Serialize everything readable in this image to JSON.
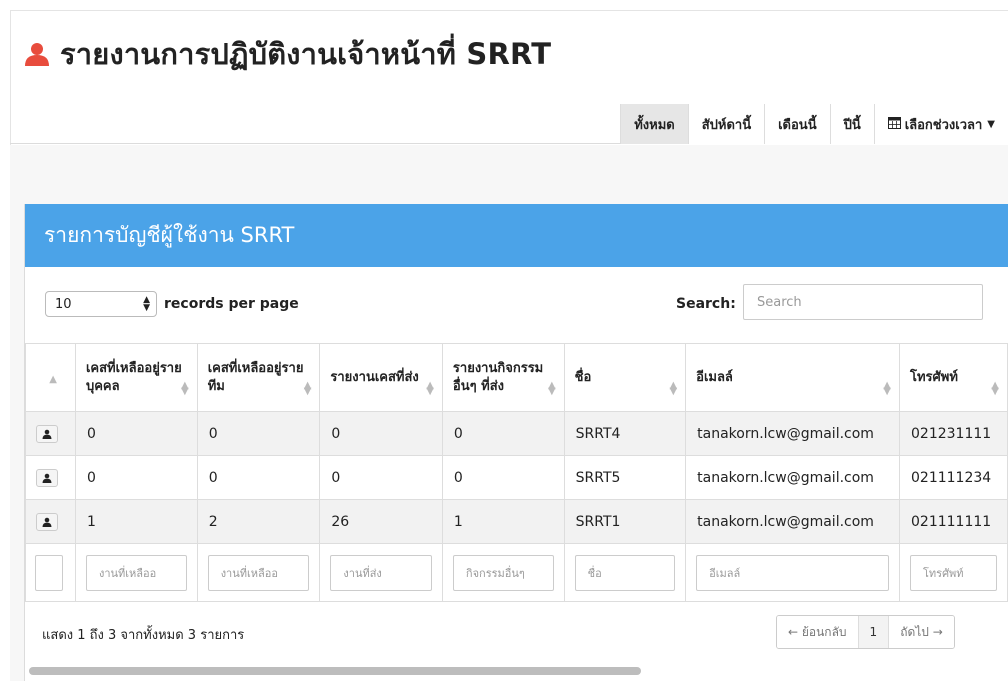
{
  "header": {
    "title": "รายงานการปฏิบัติงานเจ้าหน้าที่ SRRT",
    "icon": "user-icon",
    "icon_color": "#e84c3d"
  },
  "range_buttons": {
    "all": "ทั้งหมด",
    "week": "สัปห์ดานี้",
    "month": "เดือนนี้",
    "year": "ปีนี้",
    "custom": "เลือกช่วงเวลา"
  },
  "panel": {
    "title": "รายการบัญชีผู้ใช้งาน SRRT",
    "color": "#4ba3e8"
  },
  "controls": {
    "page_length": "10",
    "page_length_label": "records per page",
    "search_label": "Search:",
    "search_placeholder": "Search"
  },
  "table": {
    "columns": [
      "เคสที่เหลืออยู่รายบุคคล",
      "เคสที่เหลืออยู่รายทีม",
      "รายงานเคสที่ส่ง",
      "รายงานกิจกรรมอื่นๆ ที่ส่ง",
      "ชื่อ",
      "อีเมลล์",
      "โทรศัพท์"
    ],
    "rows": [
      [
        "0",
        "0",
        "0",
        "0",
        "SRRT4",
        "tanakorn.lcw@gmail.com",
        "021231111"
      ],
      [
        "0",
        "0",
        "0",
        "0",
        "SRRT5",
        "tanakorn.lcw@gmail.com",
        "021111234"
      ],
      [
        "1",
        "2",
        "26",
        "1",
        "SRRT1",
        "tanakorn.lcw@gmail.com",
        "021111111"
      ]
    ],
    "filters": [
      "งานที่เหลืออ",
      "งานที่เหลืออ",
      "งานที่ส่ง",
      "กิจกรรมอื่นๆ",
      "ชื่อ",
      "อีเมลล์",
      "โทรศัพท์"
    ]
  },
  "footer": {
    "info": "แสดง 1 ถึง 3 จากทั้งหมด 3 รายการ",
    "prev": "← ย้อนกลับ",
    "page": "1",
    "next": "ถัดไป →"
  }
}
